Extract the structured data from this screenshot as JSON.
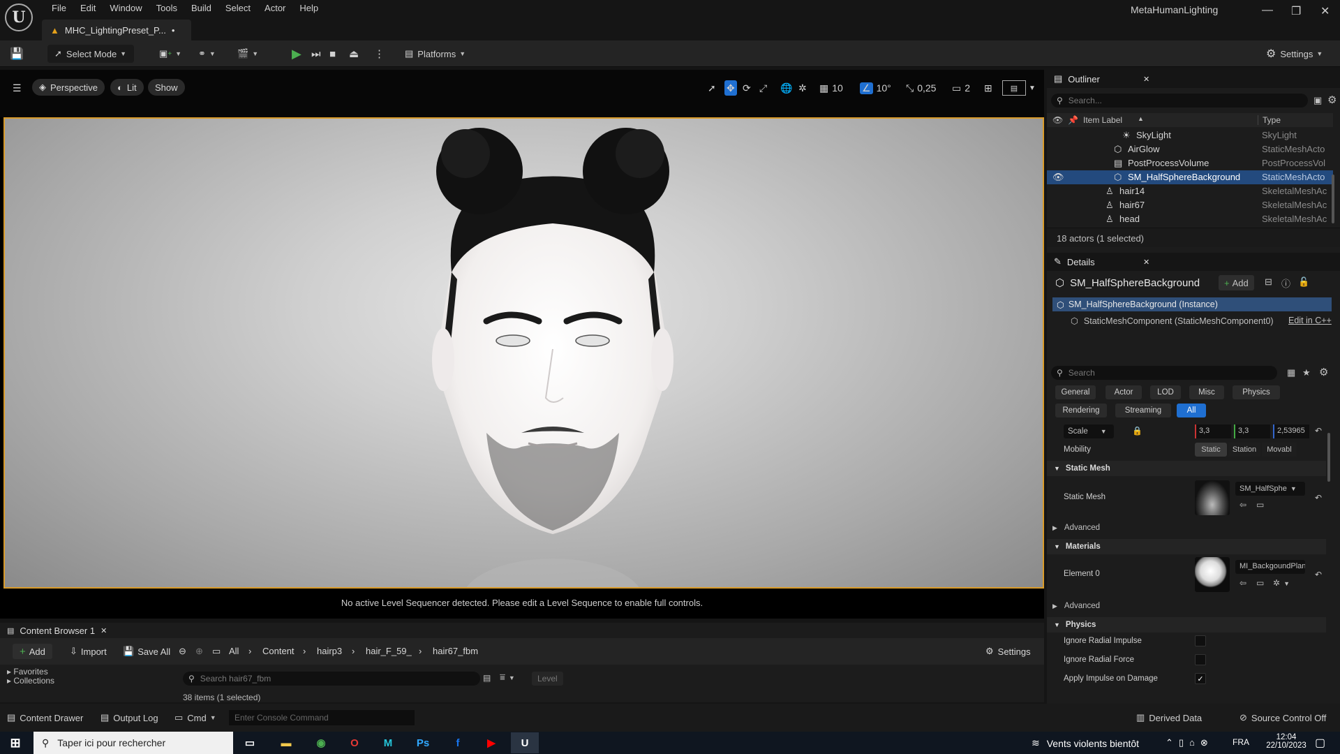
{
  "titlebar": {
    "menu": [
      "File",
      "Edit",
      "Window",
      "Tools",
      "Build",
      "Select",
      "Actor",
      "Help"
    ],
    "doc_tab": "MHC_LightingPreset_P...",
    "doc_dirty": "•",
    "project": "MetaHumanLighting",
    "logo": "U"
  },
  "toolbar": {
    "select_mode": "Select Mode",
    "platforms": "Platforms",
    "settings": "Settings"
  },
  "viewport_toolbar": {
    "perspective": "Perspective",
    "lit": "Lit",
    "show": "Show",
    "grid_snap": "10",
    "rot_snap": "10°",
    "scale_snap": "0,25",
    "camera_speed": "2"
  },
  "viewport": {
    "message": "No active Level Sequencer detected. Please edit a Level Sequence to enable full controls."
  },
  "content_browser": {
    "tab": "Content Browser 1",
    "add": "Add",
    "import": "Import",
    "save_all": "Save All",
    "crumbs": [
      "All",
      "Content",
      "hairp3",
      "hair_F_59_",
      "hair67_fbm"
    ],
    "settings": "Settings",
    "search_placeholder": "Search hair67_fbm",
    "level_filter": "Level",
    "favorites": "Favorites",
    "collections": "Collections",
    "items_count": "38 items (1 selected)"
  },
  "statusbar": {
    "content_drawer": "Content Drawer",
    "output_log": "Output Log",
    "cmd": "Cmd",
    "console_placeholder": "Enter Console Command",
    "derived_data": "Derived Data",
    "source_control": "Source Control Off"
  },
  "outliner": {
    "title": "Outliner",
    "search_placeholder": "Search...",
    "col_label": "Item Label",
    "col_type": "Type",
    "rows": [
      {
        "label": "SkyLight",
        "type": "SkyLight"
      },
      {
        "label": "AirGlow",
        "type": "StaticMeshActo"
      },
      {
        "label": "PostProcessVolume",
        "type": "PostProcessVol"
      },
      {
        "label": "SM_HalfSphereBackground",
        "type": "StaticMeshActo"
      },
      {
        "label": "hair14",
        "type": "SkeletalMeshAc"
      },
      {
        "label": "hair67",
        "type": "SkeletalMeshAc"
      },
      {
        "label": "head",
        "type": "SkeletalMeshAc"
      }
    ],
    "selected_index": 3,
    "summary": "18 actors (1 selected)"
  },
  "details": {
    "title": "Details",
    "object_name": "SM_HalfSphereBackground",
    "add": "Add",
    "instance": "SM_HalfSphereBackground (Instance)",
    "component": "StaticMeshComponent (StaticMeshComponent0)",
    "edit_cpp": "Edit in C++",
    "search_placeholder": "Search",
    "tabs_row1": [
      "General",
      "Actor",
      "LOD",
      "Misc",
      "Physics"
    ],
    "tabs_row2": [
      "Rendering",
      "Streaming",
      "All"
    ],
    "active_tab": "All",
    "scale_label": "Scale",
    "scale_x": "3,3",
    "scale_y": "3,3",
    "scale_z": "2,53965",
    "mobility_label": "Mobility",
    "mobility_options": [
      "Static",
      "Station",
      "Movabl"
    ],
    "static_mesh_section": "Static Mesh",
    "static_mesh_label": "Static Mesh",
    "static_mesh_value": "SM_HalfSphe",
    "advanced": "Advanced",
    "materials_section": "Materials",
    "element0_label": "Element 0",
    "element0_value": "MI_BackgoundPlan",
    "physics_section": "Physics",
    "physics_props": [
      {
        "label": "Ignore Radial Impulse",
        "checked": false
      },
      {
        "label": "Ignore Radial Force",
        "checked": false
      },
      {
        "label": "Apply Impulse on Damage",
        "checked": true
      }
    ]
  },
  "taskbar": {
    "search_placeholder": "Taper ici pour rechercher",
    "weather": "Vents violents bientôt",
    "lang": "FRA",
    "time": "12:04",
    "date": "22/10/2023"
  }
}
